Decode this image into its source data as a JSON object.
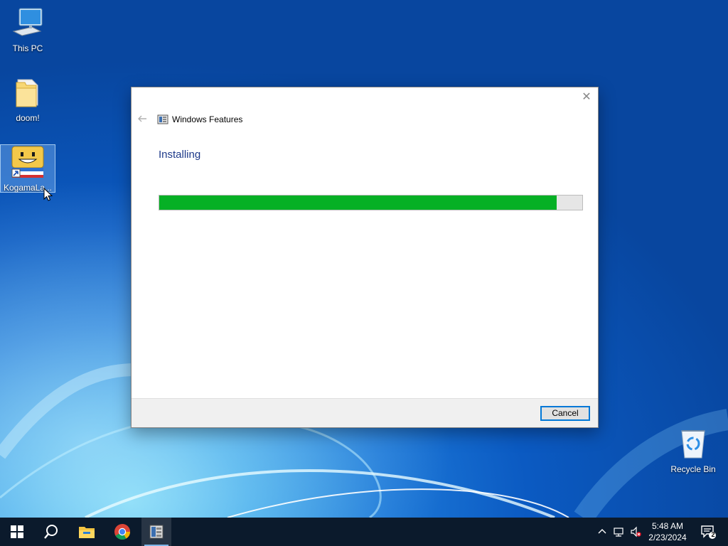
{
  "desktop": {
    "icons": [
      {
        "label": "This PC",
        "icon": "computer-icon"
      },
      {
        "label": "doom!",
        "icon": "folder-icon"
      },
      {
        "label": "KogamaLa...",
        "icon": "kogama-app-icon"
      },
      {
        "label": "Recycle Bin",
        "icon": "recycle-bin-icon"
      }
    ]
  },
  "dialog": {
    "title": "Windows Features",
    "heading": "Installing",
    "progress_percent": 94,
    "cancel_label": "Cancel",
    "progress_color": "#06b025",
    "heading_color": "#1e3a8a"
  },
  "taskbar": {
    "pinned": [
      {
        "name": "start-icon"
      },
      {
        "name": "search-icon"
      },
      {
        "name": "file-explorer-icon"
      },
      {
        "name": "chrome-icon"
      },
      {
        "name": "windows-features-app-icon",
        "active": true
      }
    ],
    "clock": {
      "time": "5:48 AM",
      "date": "2/23/2024"
    },
    "notification_count": "2"
  }
}
